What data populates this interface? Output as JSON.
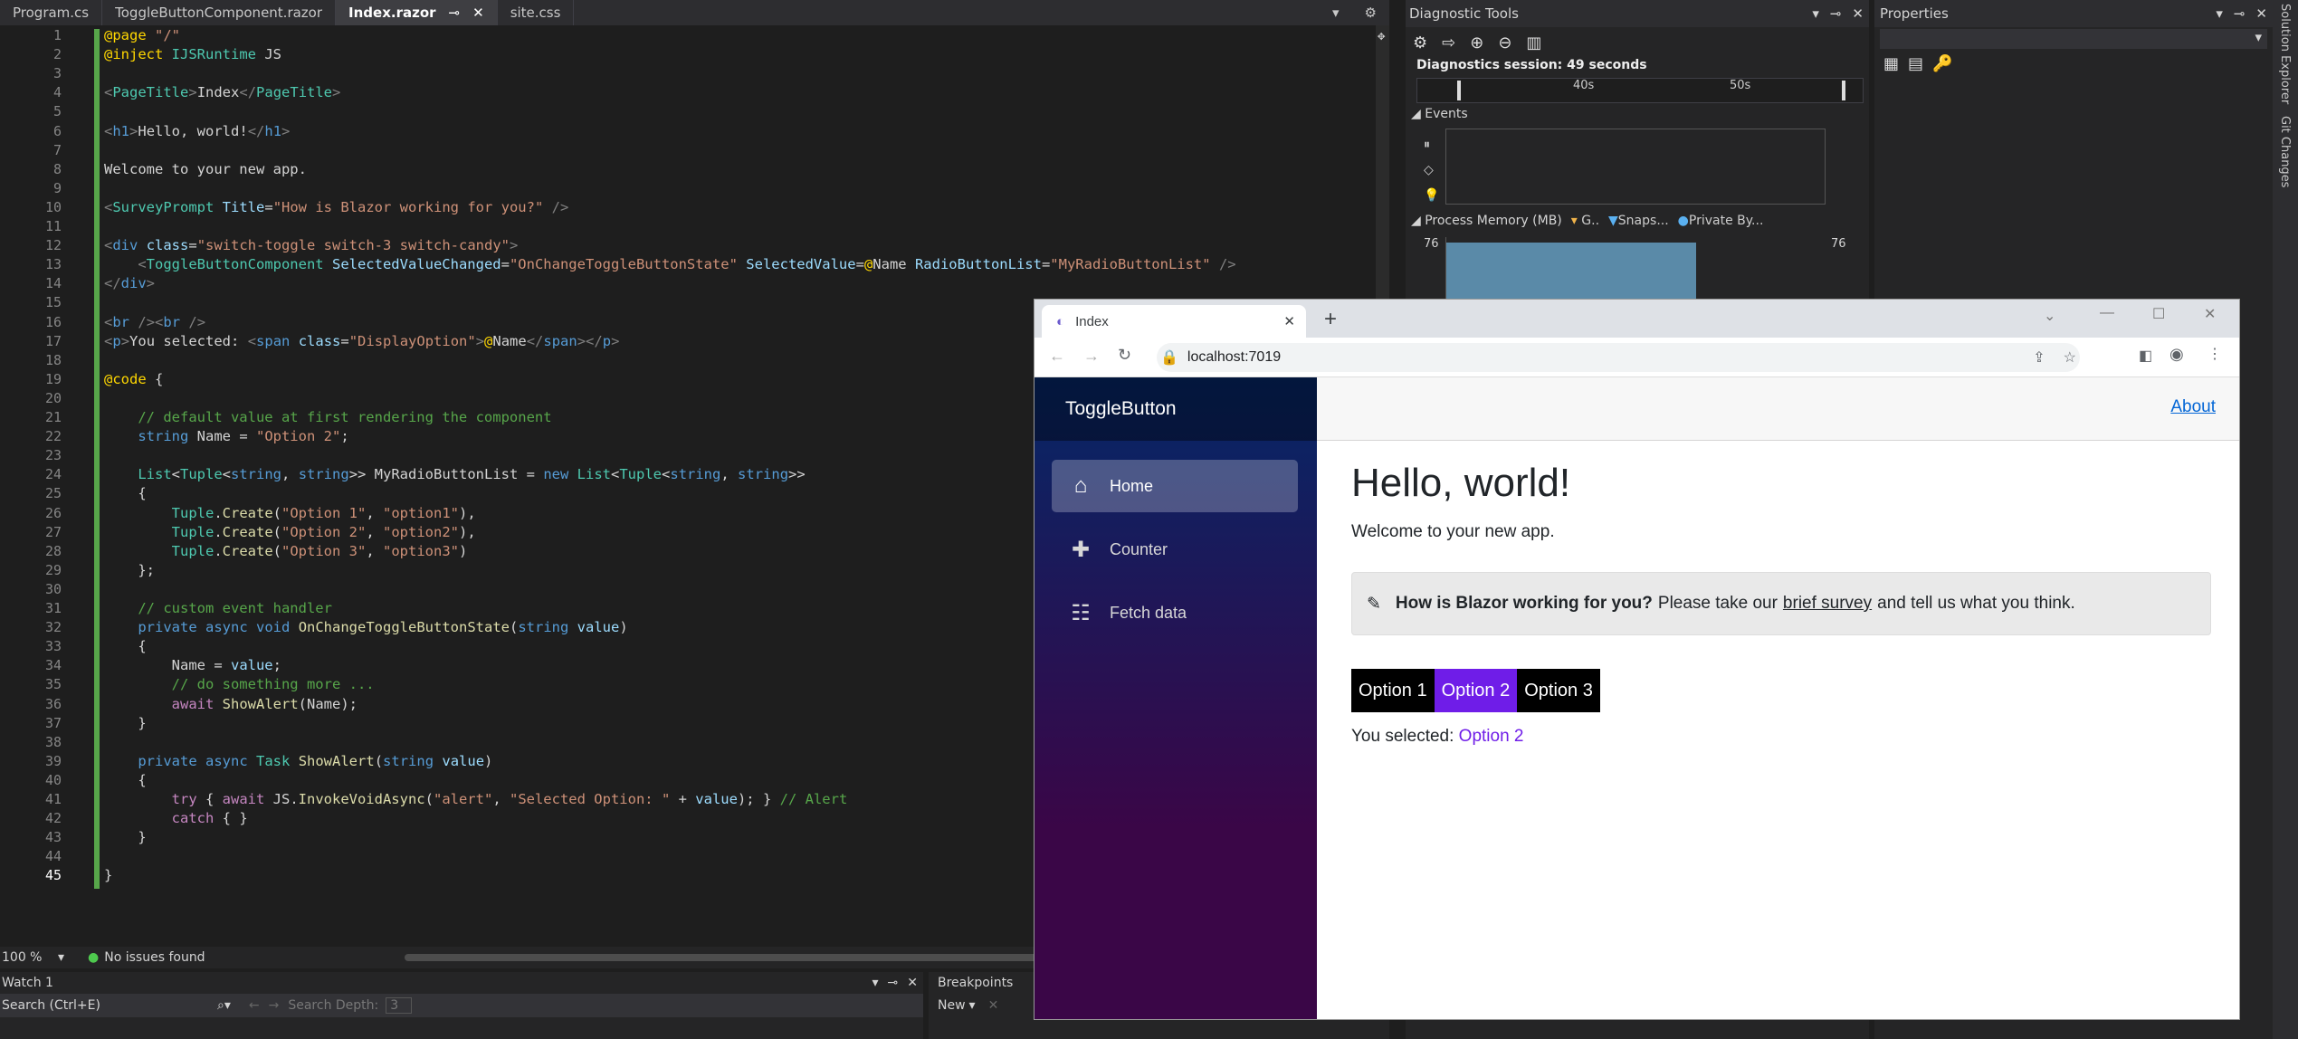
{
  "editor_tabs": [
    {
      "label": "Program.cs",
      "active": false
    },
    {
      "label": "ToggleButtonComponent.razor",
      "active": false
    },
    {
      "label": "Index.razor",
      "active": true
    },
    {
      "label": "site.css",
      "active": false
    }
  ],
  "code_lines": [
    {
      "n": "1",
      "html": "<span class='h'>@page</span> <span class='s'>\"/\"</span>"
    },
    {
      "n": "2",
      "html": "<span class='h'>@inject</span> <span class='t'>IJSRuntime</span> JS"
    },
    {
      "n": "3",
      "html": ""
    },
    {
      "n": "4",
      "html": "<span class='p'>&lt;</span><span class='t'>PageTitle</span><span class='p'>&gt;</span>Index<span class='p'>&lt;/</span><span class='t'>PageTitle</span><span class='p'>&gt;</span>"
    },
    {
      "n": "5",
      "html": ""
    },
    {
      "n": "6",
      "html": "<span class='p'>&lt;</span><span class='k'>h1</span><span class='p'>&gt;</span>Hello, world!<span class='p'>&lt;/</span><span class='k'>h1</span><span class='p'>&gt;</span>"
    },
    {
      "n": "7",
      "html": ""
    },
    {
      "n": "8",
      "html": "Welcome to your new app."
    },
    {
      "n": "9",
      "html": ""
    },
    {
      "n": "10",
      "html": "<span class='p'>&lt;</span><span class='t'>SurveyPrompt</span> <span class='a'>Title</span>=<span class='s'>\"How is Blazor working for you?\"</span> <span class='p'>/&gt;</span>"
    },
    {
      "n": "11",
      "html": ""
    },
    {
      "n": "12",
      "html": "<span class='p'>&lt;</span><span class='k'>div</span> <span class='a'>class</span>=<span class='s'>\"switch-toggle switch-3 switch-candy\"</span><span class='p'>&gt;</span>"
    },
    {
      "n": "13",
      "html": "    <span class='p'>&lt;</span><span class='t'>ToggleButtonComponent</span> <span class='a'>SelectedValueChanged</span>=<span class='s'>\"OnChangeToggleButtonState\"</span> <span class='a'>SelectedValue</span>=<span class='h'>@</span>Name <span class='a'>RadioButtonList</span>=<span class='s'>\"MyRadioButtonList\"</span> <span class='p'>/&gt;</span>"
    },
    {
      "n": "14",
      "html": "<span class='p'>&lt;/</span><span class='k'>div</span><span class='p'>&gt;</span>"
    },
    {
      "n": "15",
      "html": ""
    },
    {
      "n": "16",
      "html": "<span class='p'>&lt;</span><span class='k'>br</span> <span class='p'>/&gt;&lt;</span><span class='k'>br</span> <span class='p'>/&gt;</span>"
    },
    {
      "n": "17",
      "html": "<span class='p'>&lt;</span><span class='k'>p</span><span class='p'>&gt;</span>You selected: <span class='p'>&lt;</span><span class='k'>span</span> <span class='a'>class</span>=<span class='s'>\"DisplayOption\"</span><span class='p'>&gt;</span><span class='h'>@</span>Name<span class='p'>&lt;/</span><span class='k'>span</span><span class='p'>&gt;&lt;/</span><span class='k'>p</span><span class='p'>&gt;</span>"
    },
    {
      "n": "18",
      "html": ""
    },
    {
      "n": "19",
      "html": "<span class='h'>@code</span> {"
    },
    {
      "n": "20",
      "html": ""
    },
    {
      "n": "21",
      "html": "    <span class='c'>// default value at first rendering the component</span>"
    },
    {
      "n": "22",
      "html": "    <span class='k'>string</span> Name = <span class='s'>\"Option 2\"</span>;"
    },
    {
      "n": "23",
      "html": ""
    },
    {
      "n": "24",
      "html": "    <span class='t'>List</span>&lt;<span class='t'>Tuple</span>&lt;<span class='k'>string</span>, <span class='k'>string</span>&gt;&gt; MyRadioButtonList = <span class='k'>new</span> <span class='t'>List</span>&lt;<span class='t'>Tuple</span>&lt;<span class='k'>string</span>, <span class='k'>string</span>&gt;&gt;"
    },
    {
      "n": "25",
      "html": "    {"
    },
    {
      "n": "26",
      "html": "        <span class='t'>Tuple</span>.<span class='f'>Create</span>(<span class='s'>\"Option 1\"</span>, <span class='s'>\"option1\"</span>),"
    },
    {
      "n": "27",
      "html": "        <span class='t'>Tuple</span>.<span class='f'>Create</span>(<span class='s'>\"Option 2\"</span>, <span class='s'>\"option2\"</span>),"
    },
    {
      "n": "28",
      "html": "        <span class='t'>Tuple</span>.<span class='f'>Create</span>(<span class='s'>\"Option 3\"</span>, <span class='s'>\"option3\"</span>)"
    },
    {
      "n": "29",
      "html": "    };"
    },
    {
      "n": "30",
      "html": ""
    },
    {
      "n": "31",
      "html": "    <span class='c'>// custom event handler</span>"
    },
    {
      "n": "32",
      "html": "    <span class='k'>private</span> <span class='k'>async</span> <span class='k'>void</span> <span class='f'>OnChangeToggleButtonState</span>(<span class='k'>string</span> <span class='a'>value</span>)"
    },
    {
      "n": "33",
      "html": "    {"
    },
    {
      "n": "34",
      "html": "        Name = <span class='a'>value</span>;"
    },
    {
      "n": "35",
      "html": "        <span class='c'>// do something more ...</span>"
    },
    {
      "n": "36",
      "html": "        <span class='m'>await</span> <span class='f'>ShowAlert</span>(Name);"
    },
    {
      "n": "37",
      "html": "    }"
    },
    {
      "n": "38",
      "html": ""
    },
    {
      "n": "39",
      "html": "    <span class='k'>private</span> <span class='k'>async</span> <span class='t'>Task</span> <span class='f'>ShowAlert</span>(<span class='k'>string</span> <span class='a'>value</span>)"
    },
    {
      "n": "40",
      "html": "    {"
    },
    {
      "n": "41",
      "html": "        <span class='m'>try</span> { <span class='m'>await</span> JS.<span class='f'>InvokeVoidAsync</span>(<span class='s'>\"alert\"</span>, <span class='s'>\"Selected Option: \"</span> + <span class='a'>value</span>); } <span class='c'>// Alert</span>"
    },
    {
      "n": "42",
      "html": "        <span class='m'>catch</span> { }"
    },
    {
      "n": "43",
      "html": "    }"
    },
    {
      "n": "44",
      "html": ""
    },
    {
      "n": "45",
      "html": "}"
    }
  ],
  "status": {
    "zoom": "100 %",
    "issues": "No issues found"
  },
  "watch": {
    "title": "Watch 1",
    "search_placeholder": "Search (Ctrl+E)",
    "depth_label": "Search Depth:",
    "depth_value": "3"
  },
  "breakpoints": {
    "title": "Breakpoints",
    "new_label": "New"
  },
  "diagnostics": {
    "title": "Diagnostic Tools",
    "session": "Diagnostics session: 49 seconds",
    "tick1": "40s",
    "tick2": "50s",
    "events": "Events",
    "memory": "Process Memory (MB)",
    "legend_gc": "G..",
    "legend_snap": "Snaps...",
    "legend_private": "Private By...",
    "mem_left": "76",
    "mem_right": "76"
  },
  "properties": {
    "title": "Properties"
  },
  "side_tabs": {
    "solution_explorer": "Solution Explorer",
    "git_changes": "Git Changes"
  },
  "browser": {
    "tab_title": "Index",
    "url": "localhost:7019",
    "brand": "ToggleButton",
    "nav": [
      {
        "label": "Home",
        "icon": "home-icon",
        "active": true
      },
      {
        "label": "Counter",
        "icon": "plus-icon",
        "active": false
      },
      {
        "label": "Fetch data",
        "icon": "list-icon",
        "active": false
      }
    ],
    "about": "About",
    "heading": "Hello, world!",
    "welcome": "Welcome to your new app.",
    "survey": {
      "bold": "How is Blazor working for you?",
      "pre": "Please take our",
      "link": "brief survey",
      "post": "and tell us what you think."
    },
    "toggle": [
      {
        "label": "Option 1",
        "selected": false
      },
      {
        "label": "Option 2",
        "selected": true
      },
      {
        "label": "Option 3",
        "selected": false
      }
    ],
    "selected_label": "You selected:",
    "selected_value": "Option 2"
  },
  "colors": {
    "accent_purple": "#6f1de8",
    "vs_bg": "#1e1e1e"
  }
}
